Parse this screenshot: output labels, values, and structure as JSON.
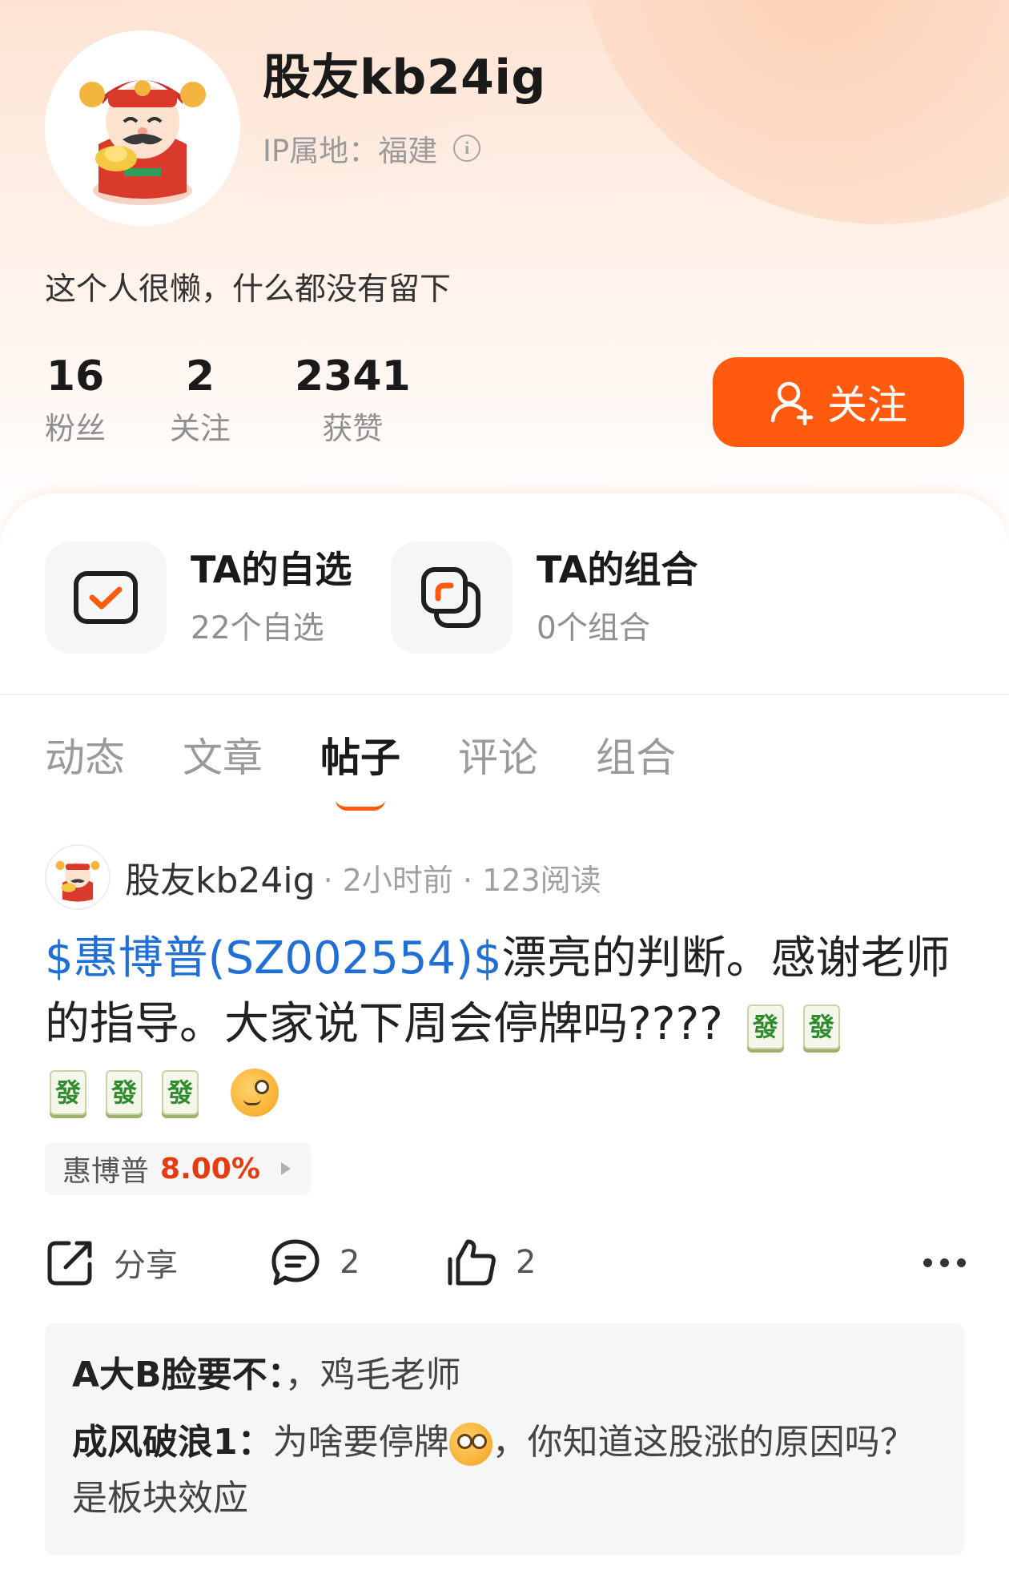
{
  "profile": {
    "username": "股友kb24ig",
    "ip_location": "IP属地：福建",
    "bio": "这个人很懒，什么都没有留下",
    "stats": [
      {
        "value": "16",
        "label": "粉丝"
      },
      {
        "value": "2",
        "label": "关注"
      },
      {
        "value": "2341",
        "label": "获赞"
      }
    ],
    "follow_label": "关注"
  },
  "quick_links": [
    {
      "title": "TA的自选",
      "subtitle": "22个自选"
    },
    {
      "title": "TA的组合",
      "subtitle": "0个组合"
    }
  ],
  "tabs": [
    {
      "label": "动态"
    },
    {
      "label": "文章"
    },
    {
      "label": "帖子",
      "active": true
    },
    {
      "label": "评论"
    },
    {
      "label": "组合"
    }
  ],
  "post": {
    "author": "股友kb24ig",
    "meta": "· 2小时前 · 123阅读",
    "stock_tag": "$惠博普(SZ002554)$",
    "text": "漂亮的判断。感谢老师的指导。大家说下周会停牌吗????",
    "tile_char": "發",
    "stock_chip": {
      "name": "惠博普",
      "change": "8.00%"
    },
    "share_label": "分享",
    "comment_count": "2",
    "like_count": "2"
  },
  "comments": [
    {
      "user": "A大B脸要不：",
      "text": "，鸡毛老师"
    },
    {
      "user": "成风破浪1：",
      "text_before": "为啥要停牌",
      "text_after": "，你知道这股涨的原因吗？是板块效应"
    }
  ],
  "colors": {
    "accent": "#ff5a0d",
    "stock_link": "#1f6fd6",
    "rise": "#e63b10"
  }
}
